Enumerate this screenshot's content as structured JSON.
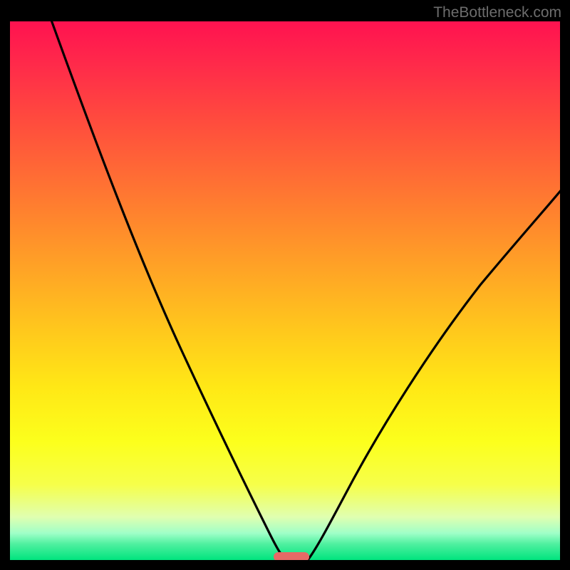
{
  "attribution": "TheBottleneck.com",
  "chart_data": {
    "type": "line",
    "title": "",
    "xlabel": "",
    "ylabel": "",
    "xlim": [
      0,
      100
    ],
    "ylim": [
      0,
      100
    ],
    "x": [
      0,
      5,
      10,
      15,
      20,
      25,
      30,
      35,
      40,
      45,
      47,
      50,
      53,
      55,
      60,
      65,
      70,
      75,
      80,
      85,
      90,
      95,
      100
    ],
    "series": [
      {
        "name": "left-curve",
        "values": [
          100,
          93,
          86,
          79,
          72,
          64,
          56,
          47,
          37,
          22,
          12,
          0,
          null,
          null,
          null,
          null,
          null,
          null,
          null,
          null,
          null,
          null,
          null
        ]
      },
      {
        "name": "right-curve",
        "values": [
          null,
          null,
          null,
          null,
          null,
          null,
          null,
          null,
          null,
          null,
          null,
          null,
          0,
          10,
          24,
          34,
          42,
          49,
          55,
          60,
          64,
          68,
          71
        ]
      }
    ],
    "marker": {
      "x": 50,
      "y": 0,
      "label": ""
    }
  },
  "colors": {
    "curve": "#000000",
    "marker": "#e66a66",
    "attribution": "#6d6d6d"
  }
}
